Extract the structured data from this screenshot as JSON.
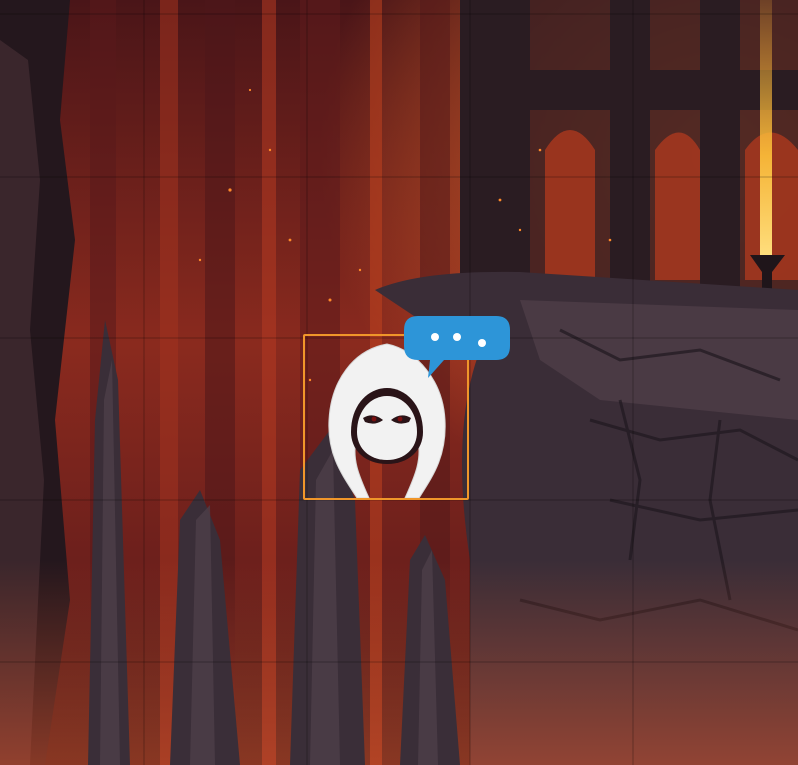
{
  "scene": {
    "name": "volcanic-ruins-battle-map",
    "grid": {
      "visible": true,
      "color": "#000000"
    },
    "palette": {
      "sky_top": "#3a1216",
      "lava_glow": "#d9451f",
      "rock_dark": "#2a1e26",
      "rock_mid": "#3b2c36",
      "ember": "#ff8a2a"
    }
  },
  "token": {
    "icon": "hooded-figure-icon",
    "selected": true,
    "selection_color": "#f0962a",
    "icon_color": "#f2f2f2",
    "eye_color": "#7a1010"
  },
  "status_bubble": {
    "icon": "typing-indicator-icon",
    "color": "#2d95d8",
    "text": "• • •"
  }
}
